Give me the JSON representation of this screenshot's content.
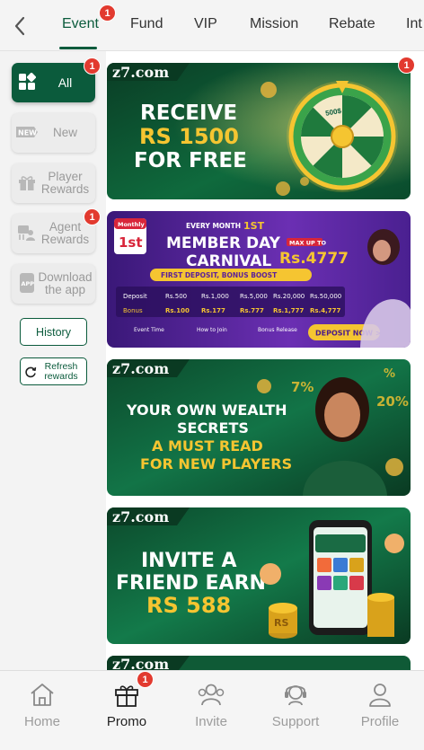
{
  "tabs": [
    {
      "label": "Event",
      "active": true,
      "badge": "1"
    },
    {
      "label": "Fund"
    },
    {
      "label": "VIP"
    },
    {
      "label": "Mission"
    },
    {
      "label": "Rebate"
    },
    {
      "label": "Int"
    }
  ],
  "sidebar": {
    "items": [
      {
        "label": "All",
        "icon": "grid-icon",
        "active": true,
        "badge": "1"
      },
      {
        "label": "New",
        "icon": "new-tag-icon"
      },
      {
        "label": "Player Rewards",
        "icon": "gift-icon"
      },
      {
        "label": "Agent Rewards",
        "icon": "agent-icon",
        "badge": "1"
      },
      {
        "label": "Download the app",
        "icon": "app-icon"
      }
    ],
    "history_label": "History",
    "refresh_label": "Refresh rewards"
  },
  "banners": {
    "b1": {
      "badge": "1",
      "brand": "z7.com",
      "line1": "RECEIVE",
      "line2": "RS 1500",
      "line3": "FOR FREE",
      "wheel_value": "500$"
    },
    "b2": {
      "calendar_top": "Monthly",
      "calendar_day": "1st",
      "every_month": "EVERY MONTH",
      "every_month_suffix": "1ST",
      "title1": "MEMBER DAY",
      "title2": "CARNIVAL",
      "max_up_to": "MAX UP TO",
      "max_value": "Rs.4777",
      "subtitle": "FIRST DEPOSIT, BONUS BOOST",
      "row1": [
        "Deposit",
        "Rs.500",
        "Rs.1,000",
        "Rs.5,000",
        "Rs.20,000",
        "Rs.50,000"
      ],
      "row2": [
        "Bonus",
        "Rs.100",
        "Rs.177",
        "Rs.777",
        "Rs.1,777",
        "Rs.4,777"
      ],
      "footer1": "Event Time",
      "footer2": "How to Join",
      "footer3": "Bonus Release",
      "cta": "DEPOSIT NOW >"
    },
    "b3": {
      "brand": "z7.com",
      "line1": "YOUR OWN WEALTH",
      "line2": "SECRETS",
      "line3": "A MUST READ",
      "line4": "FOR NEW PLAYERS",
      "pct1": "7%",
      "pct2": "20%",
      "pct3": "%"
    },
    "b4": {
      "brand": "z7.com",
      "line1": "INVITE A",
      "line2": "FRIEND EARN",
      "line3": "RS 588",
      "coin_label": "RS"
    },
    "b5": {
      "brand": "z7.com"
    }
  },
  "bottom_nav": [
    {
      "label": "Home",
      "icon": "home-icon"
    },
    {
      "label": "Promo",
      "icon": "gift-icon",
      "active": true,
      "badge": "1"
    },
    {
      "label": "Invite",
      "icon": "invite-icon"
    },
    {
      "label": "Support",
      "icon": "support-icon"
    },
    {
      "label": "Profile",
      "icon": "profile-icon"
    }
  ],
  "colors": {
    "primary": "#0b5b3c",
    "badge": "#e23a2f",
    "gold": "#f5c531",
    "purple": "#5b2a9e"
  }
}
